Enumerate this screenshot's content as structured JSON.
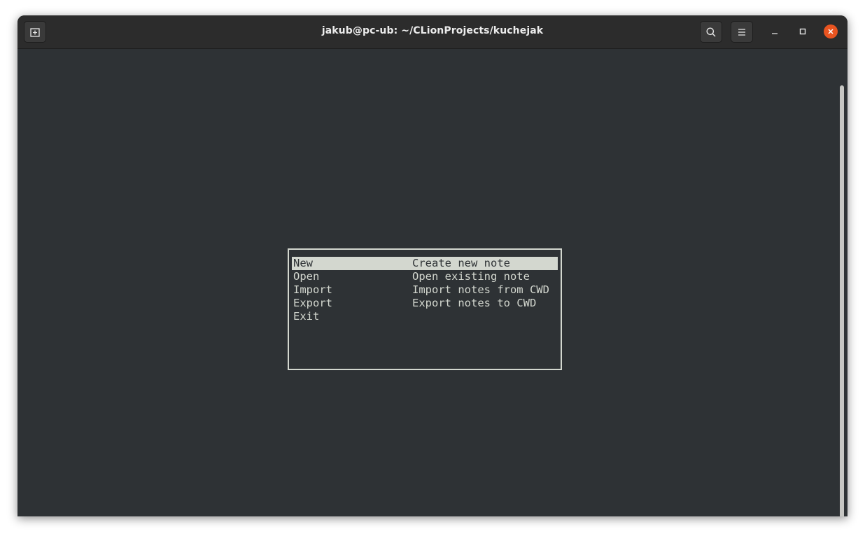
{
  "window": {
    "title": "jakub@pc-ub: ~/CLionProjects/kuchejak",
    "controls": [
      "new-tab-icon",
      "search-icon",
      "hamburger-menu-icon",
      "minimize-icon",
      "maximize-icon",
      "close-icon"
    ],
    "accent_close": "#e95420"
  },
  "terminal": {
    "background": "#2e3235",
    "foreground": "#d3d7cf",
    "menu": {
      "selected_index": 0,
      "items": [
        {
          "name": "New",
          "description": "Create new note"
        },
        {
          "name": "Open",
          "description": "Open existing note"
        },
        {
          "name": "Import",
          "description": "Import notes from CWD"
        },
        {
          "name": "Export",
          "description": "Export notes to CWD"
        },
        {
          "name": "Exit",
          "description": ""
        }
      ]
    }
  }
}
